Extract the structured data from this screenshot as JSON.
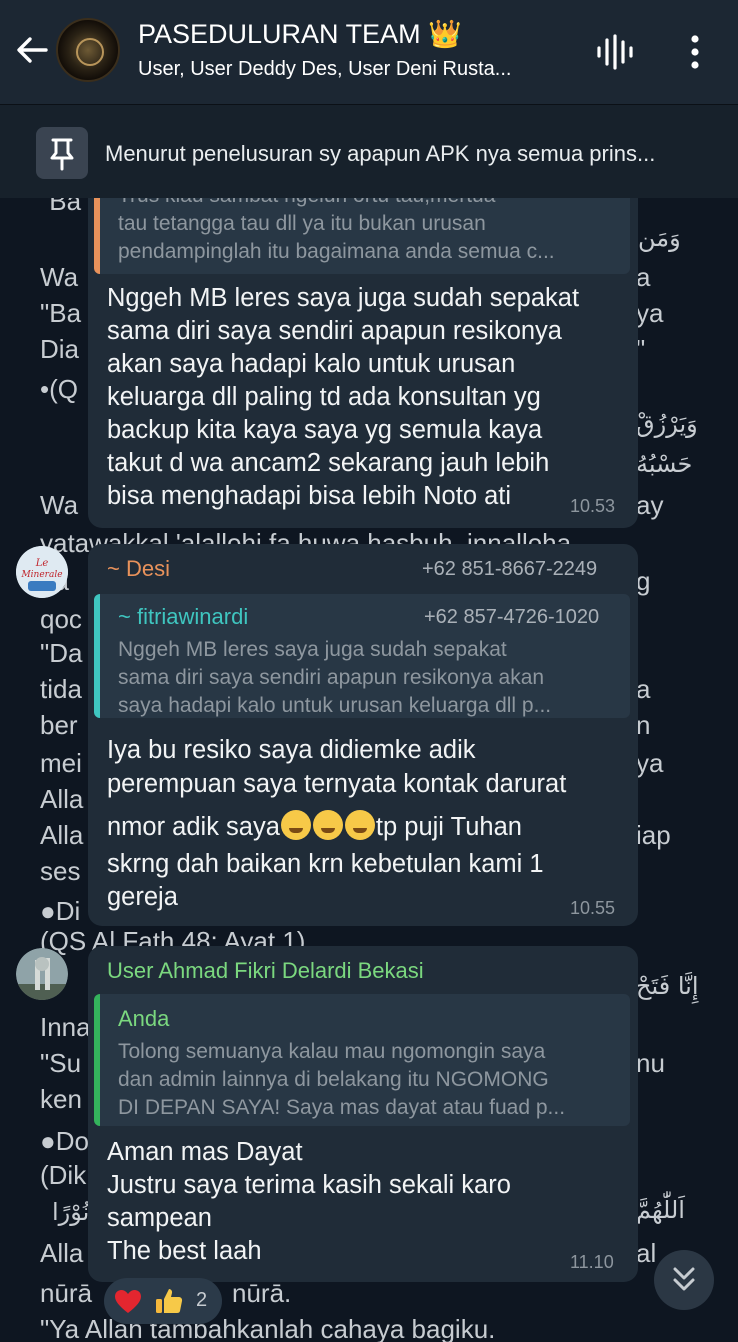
{
  "header": {
    "title": "PASEDULURAN TEAM 👑",
    "subtitle": "User, User Deddy Des, User Deni Rusta..."
  },
  "pinned": {
    "text": "Menurut penelusuran sy apapun APK nya semua prins..."
  },
  "background": {
    "left": [
      "\"Ba",
      "Wa",
      "\"Ba",
      "Dia",
      "•(Q",
      "Wa",
      "yatawakkal 'alallohi fa huwa hasbuh, innalloha",
      "ba",
      "qoc",
      "\"Da",
      "tida",
      "ber",
      "mei",
      "Alla",
      "Alla",
      "ses",
      "●Di",
      "(QS  Al Fath 48: Ayat 1)",
      "Inna",
      "\"Su",
      "ken",
      "●Do",
      "(Dik",
      "Alla",
      "nūrā",
      "nūrā.",
      "\"Ya Allah tambahkanlah cahaya bagiku."
    ],
    "right": [
      "a",
      "ya",
      "\"",
      "ay",
      "g",
      "a",
      "n",
      "ya",
      "iap",
      "nu",
      "al"
    ],
    "arabic": [
      "وَمَن",
      "وَيَرْزُقْ",
      "حَسْبُهُ",
      "إِنَّا فَتَحْ",
      "اَللّٰهُمَّ",
      "نُوْرًا"
    ]
  },
  "messages": [
    {
      "quote_lines": [
        "Trus klau sambat ngeluh ortu tau,mertua",
        "tau tetangga tau dll ya itu bukan urusan",
        "pendampinglah itu bagaimana anda semua c..."
      ],
      "lines": [
        "Nggeh MB leres saya juga sudah sepakat",
        "sama diri saya sendiri apapun resikonya",
        "akan saya hadapi kalo untuk urusan",
        "keluarga dll paling td ada konsultan yg",
        "backup kita kaya saya yg semula kaya",
        "takut d wa ancam2 sekarang jauh lebih",
        "bisa menghadapi bisa lebih Noto ati"
      ],
      "time": "10.53"
    },
    {
      "sender": "~ Desi",
      "phone": "+62 851-8667-2249",
      "avatar_label": "Le Minerale",
      "quote_name": "~ fitriawinardi",
      "quote_phone": "+62 857-4726-1020",
      "quote_lines": [
        "Nggeh MB leres saya juga sudah sepakat",
        "sama diri saya sendiri apapun resikonya akan",
        "saya hadapi kalo untuk urusan keluarga dll p..."
      ],
      "lines": [
        "Iya bu resiko saya didiemke adik",
        "perempuan saya ternyata kontak darurat",
        "nmor adik saya",
        "tp puji Tuhan",
        "skrng dah baikan krn kebetulan kami 1",
        "gereja"
      ],
      "time": "10.55"
    },
    {
      "sender": "User Ahmad Fikri Delardi Bekasi",
      "quote_name": "Anda",
      "quote_lines": [
        "Tolong semuanya kalau mau ngomongin saya",
        "dan admin lainnya di belakang itu NGOMONG",
        "DI DEPAN SAYA! Saya mas dayat atau fuad p..."
      ],
      "lines": [
        "Aman mas Dayat",
        "Justru saya terima kasih sekali karo",
        "sampean",
        "The best laah"
      ],
      "time": "11.10"
    }
  ],
  "reactions": {
    "heart": "❤️",
    "thumbs": "👍",
    "count": "2"
  },
  "colors": {
    "bg": "#0e1621",
    "header": "#1c2733",
    "bubble": "#202c38",
    "desi": "#e8925b",
    "ahmad": "#7bd87f",
    "quote_orange": "#e8925b",
    "quote_teal": "#3fc6c0",
    "quote_green": "#34b35c"
  }
}
